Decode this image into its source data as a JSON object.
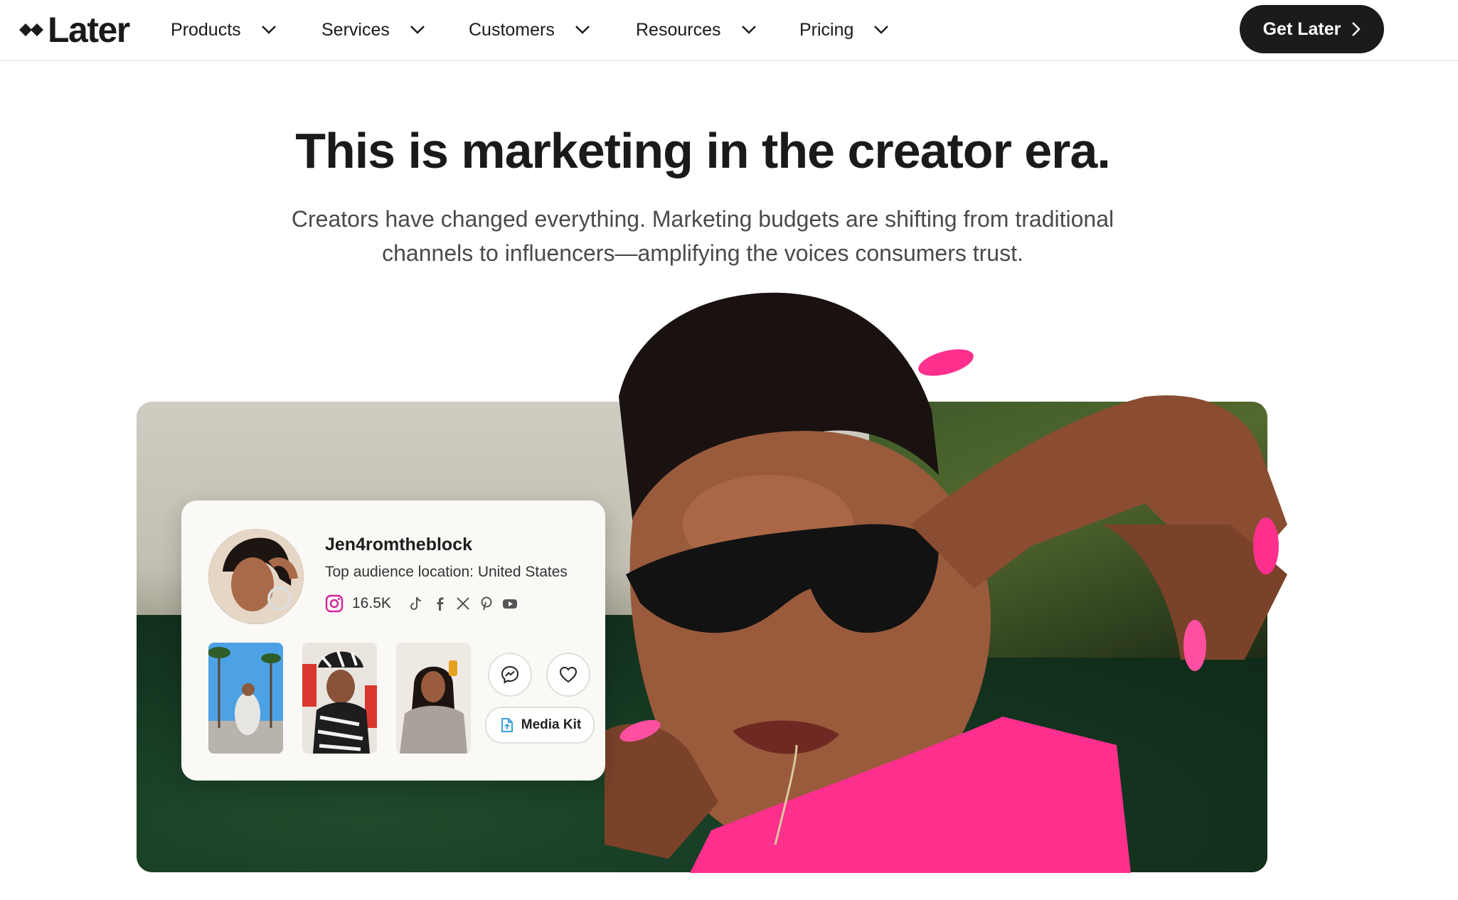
{
  "brand": {
    "name": "Later"
  },
  "nav": {
    "items": [
      {
        "label": "Products"
      },
      {
        "label": "Services"
      },
      {
        "label": "Customers"
      },
      {
        "label": "Resources"
      },
      {
        "label": "Pricing"
      }
    ],
    "cta_label": "Get Later"
  },
  "hero": {
    "title": "This is marketing in the creator era.",
    "subtitle_line1": "Creators have changed everything. Marketing budgets are shifting from traditional",
    "subtitle_line2": "channels to influencers—amplifying the voices consumers trust."
  },
  "creator_card": {
    "name": "Jen4romtheblock",
    "location": "Top audience location: United States",
    "followers": "16.5K",
    "social_icons": [
      "instagram-icon",
      "tiktok-icon",
      "facebook-icon",
      "x-icon",
      "pinterest-icon",
      "youtube-icon"
    ],
    "media_kit_label": "Media Kit"
  },
  "colors": {
    "accent_dark": "#1b1b1b",
    "instagram": "#d6249f",
    "media_kit_icon": "#3aa0d6",
    "top_pink": "#ff2f8e"
  }
}
